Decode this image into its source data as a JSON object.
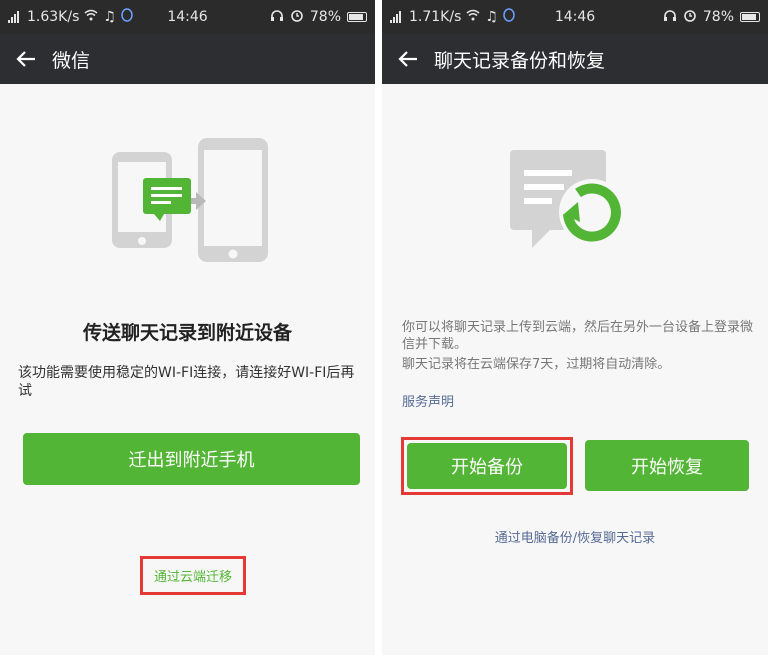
{
  "colors": {
    "accent_green": "#53b535",
    "link_blue": "#576b95",
    "highlight_red": "#e53935",
    "titlebar": "#2d2e32"
  },
  "left": {
    "status": {
      "speed": "1.63K/s",
      "time": "14:46",
      "battery": "78%"
    },
    "title": "微信",
    "heading": "传送聊天记录到附近设备",
    "description": "该功能需要使用稳定的WI-FI连接，请连接好WI-FI后再试",
    "primary_button": "迁出到附近手机",
    "cloud_link": "通过云端迁移",
    "icons": [
      "back-arrow-icon",
      "phone-transfer-illustration"
    ]
  },
  "right": {
    "status": {
      "speed": "1.71K/s",
      "time": "14:46",
      "battery": "78%"
    },
    "title": "聊天记录备份和恢复",
    "description_1": "你可以将聊天记录上传到云端，然后在另外一台设备上登录微信并下载。",
    "description_2": "聊天记录将在云端保存7天，过期将自动清除。",
    "service_link": "服务声明",
    "backup_button": "开始备份",
    "restore_button": "开始恢复",
    "pc_link": "通过电脑备份/恢复聊天记录",
    "icons": [
      "back-arrow-icon",
      "chat-sync-illustration"
    ]
  }
}
